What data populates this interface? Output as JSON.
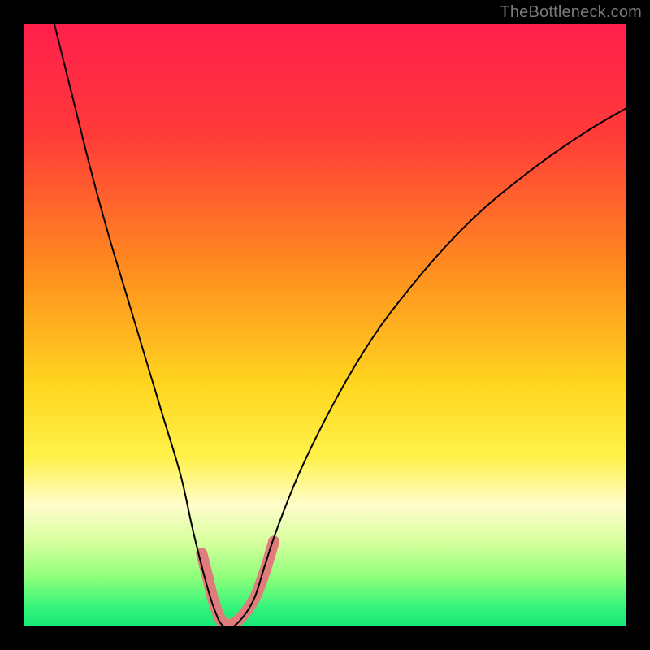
{
  "watermark": "TheBottleneck.com",
  "chart_data": {
    "type": "line",
    "title": "",
    "xlabel": "",
    "ylabel": "",
    "xlim": [
      0,
      100
    ],
    "ylim": [
      0,
      100
    ],
    "gradient_stops": [
      {
        "offset": 0,
        "color": "#ff1f4b"
      },
      {
        "offset": 18,
        "color": "#ff3a3a"
      },
      {
        "offset": 40,
        "color": "#ff8a1f"
      },
      {
        "offset": 60,
        "color": "#ffd61f"
      },
      {
        "offset": 72,
        "color": "#fff24a"
      },
      {
        "offset": 80,
        "color": "#fffccc"
      },
      {
        "offset": 86,
        "color": "#d8ff9e"
      },
      {
        "offset": 92,
        "color": "#8dff7a"
      },
      {
        "offset": 97,
        "color": "#34f47a"
      },
      {
        "offset": 100,
        "color": "#17e877"
      }
    ],
    "series": [
      {
        "name": "bottleneck-curve",
        "stroke": "#000000",
        "stroke_width": 2,
        "x": [
          5,
          8,
          11,
          14,
          17,
          20,
          23,
          26,
          28,
          30,
          31.5,
          33,
          35,
          38,
          40,
          42,
          46,
          52,
          58,
          64,
          70,
          76,
          82,
          88,
          94,
          100
        ],
        "y": [
          100,
          88,
          76,
          65,
          55,
          45,
          35,
          25,
          16,
          8,
          3,
          0,
          0,
          4,
          10,
          16,
          26,
          38,
          48,
          56,
          63,
          69,
          74,
          78.5,
          82.5,
          86
        ]
      },
      {
        "name": "highlight-segment",
        "stroke": "#e17c7c",
        "stroke_width": 14,
        "linecap": "round",
        "x": [
          29.5,
          30.5,
          31.5,
          33,
          35,
          37,
          38.5,
          40,
          41.5
        ],
        "y": [
          12,
          8,
          4,
          0.5,
          0.5,
          2.5,
          5,
          9,
          14
        ]
      }
    ]
  }
}
